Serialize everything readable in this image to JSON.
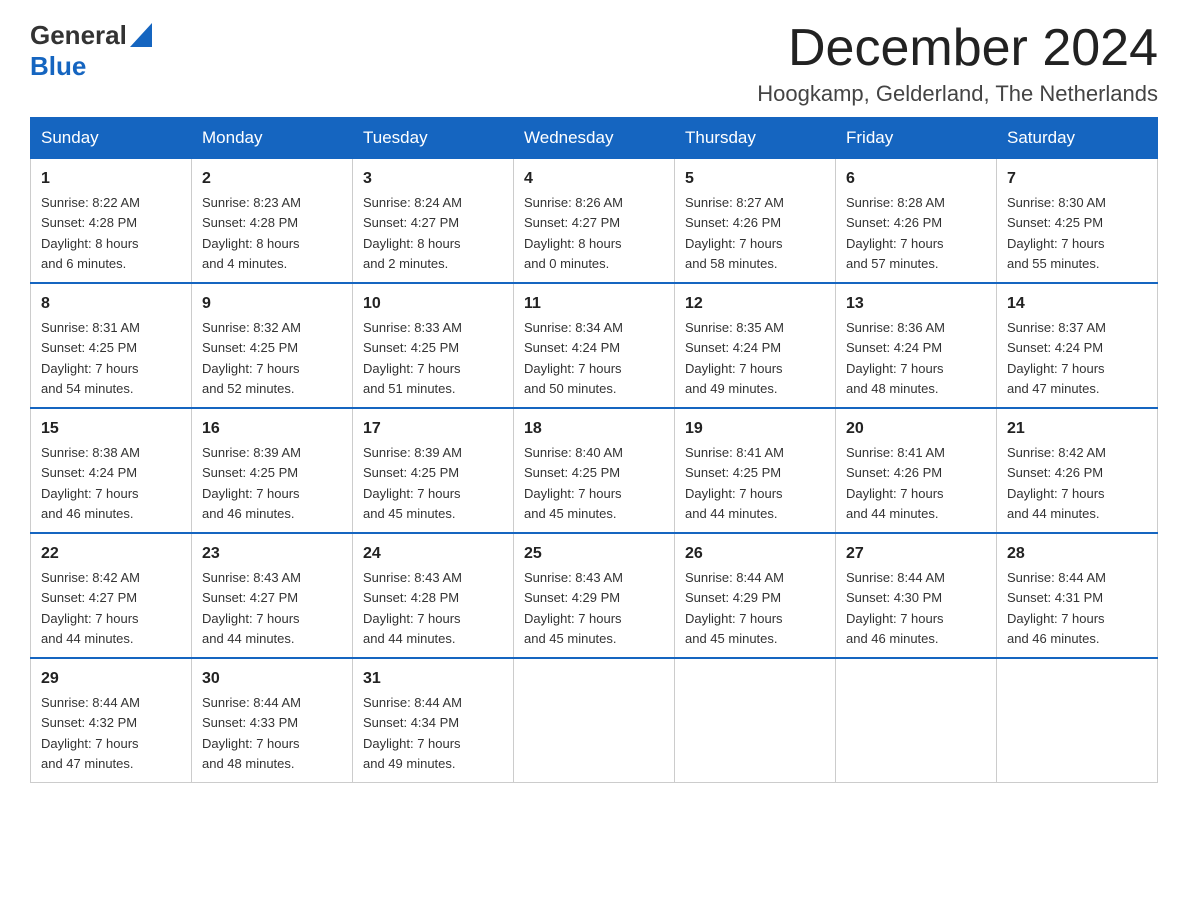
{
  "header": {
    "logo_general": "General",
    "logo_blue": "Blue",
    "month_title": "December 2024",
    "subtitle": "Hoogkamp, Gelderland, The Netherlands"
  },
  "days_of_week": [
    "Sunday",
    "Monday",
    "Tuesday",
    "Wednesday",
    "Thursday",
    "Friday",
    "Saturday"
  ],
  "weeks": [
    [
      {
        "day": "1",
        "info": "Sunrise: 8:22 AM\nSunset: 4:28 PM\nDaylight: 8 hours\nand 6 minutes."
      },
      {
        "day": "2",
        "info": "Sunrise: 8:23 AM\nSunset: 4:28 PM\nDaylight: 8 hours\nand 4 minutes."
      },
      {
        "day": "3",
        "info": "Sunrise: 8:24 AM\nSunset: 4:27 PM\nDaylight: 8 hours\nand 2 minutes."
      },
      {
        "day": "4",
        "info": "Sunrise: 8:26 AM\nSunset: 4:27 PM\nDaylight: 8 hours\nand 0 minutes."
      },
      {
        "day": "5",
        "info": "Sunrise: 8:27 AM\nSunset: 4:26 PM\nDaylight: 7 hours\nand 58 minutes."
      },
      {
        "day": "6",
        "info": "Sunrise: 8:28 AM\nSunset: 4:26 PM\nDaylight: 7 hours\nand 57 minutes."
      },
      {
        "day": "7",
        "info": "Sunrise: 8:30 AM\nSunset: 4:25 PM\nDaylight: 7 hours\nand 55 minutes."
      }
    ],
    [
      {
        "day": "8",
        "info": "Sunrise: 8:31 AM\nSunset: 4:25 PM\nDaylight: 7 hours\nand 54 minutes."
      },
      {
        "day": "9",
        "info": "Sunrise: 8:32 AM\nSunset: 4:25 PM\nDaylight: 7 hours\nand 52 minutes."
      },
      {
        "day": "10",
        "info": "Sunrise: 8:33 AM\nSunset: 4:25 PM\nDaylight: 7 hours\nand 51 minutes."
      },
      {
        "day": "11",
        "info": "Sunrise: 8:34 AM\nSunset: 4:24 PM\nDaylight: 7 hours\nand 50 minutes."
      },
      {
        "day": "12",
        "info": "Sunrise: 8:35 AM\nSunset: 4:24 PM\nDaylight: 7 hours\nand 49 minutes."
      },
      {
        "day": "13",
        "info": "Sunrise: 8:36 AM\nSunset: 4:24 PM\nDaylight: 7 hours\nand 48 minutes."
      },
      {
        "day": "14",
        "info": "Sunrise: 8:37 AM\nSunset: 4:24 PM\nDaylight: 7 hours\nand 47 minutes."
      }
    ],
    [
      {
        "day": "15",
        "info": "Sunrise: 8:38 AM\nSunset: 4:24 PM\nDaylight: 7 hours\nand 46 minutes."
      },
      {
        "day": "16",
        "info": "Sunrise: 8:39 AM\nSunset: 4:25 PM\nDaylight: 7 hours\nand 46 minutes."
      },
      {
        "day": "17",
        "info": "Sunrise: 8:39 AM\nSunset: 4:25 PM\nDaylight: 7 hours\nand 45 minutes."
      },
      {
        "day": "18",
        "info": "Sunrise: 8:40 AM\nSunset: 4:25 PM\nDaylight: 7 hours\nand 45 minutes."
      },
      {
        "day": "19",
        "info": "Sunrise: 8:41 AM\nSunset: 4:25 PM\nDaylight: 7 hours\nand 44 minutes."
      },
      {
        "day": "20",
        "info": "Sunrise: 8:41 AM\nSunset: 4:26 PM\nDaylight: 7 hours\nand 44 minutes."
      },
      {
        "day": "21",
        "info": "Sunrise: 8:42 AM\nSunset: 4:26 PM\nDaylight: 7 hours\nand 44 minutes."
      }
    ],
    [
      {
        "day": "22",
        "info": "Sunrise: 8:42 AM\nSunset: 4:27 PM\nDaylight: 7 hours\nand 44 minutes."
      },
      {
        "day": "23",
        "info": "Sunrise: 8:43 AM\nSunset: 4:27 PM\nDaylight: 7 hours\nand 44 minutes."
      },
      {
        "day": "24",
        "info": "Sunrise: 8:43 AM\nSunset: 4:28 PM\nDaylight: 7 hours\nand 44 minutes."
      },
      {
        "day": "25",
        "info": "Sunrise: 8:43 AM\nSunset: 4:29 PM\nDaylight: 7 hours\nand 45 minutes."
      },
      {
        "day": "26",
        "info": "Sunrise: 8:44 AM\nSunset: 4:29 PM\nDaylight: 7 hours\nand 45 minutes."
      },
      {
        "day": "27",
        "info": "Sunrise: 8:44 AM\nSunset: 4:30 PM\nDaylight: 7 hours\nand 46 minutes."
      },
      {
        "day": "28",
        "info": "Sunrise: 8:44 AM\nSunset: 4:31 PM\nDaylight: 7 hours\nand 46 minutes."
      }
    ],
    [
      {
        "day": "29",
        "info": "Sunrise: 8:44 AM\nSunset: 4:32 PM\nDaylight: 7 hours\nand 47 minutes."
      },
      {
        "day": "30",
        "info": "Sunrise: 8:44 AM\nSunset: 4:33 PM\nDaylight: 7 hours\nand 48 minutes."
      },
      {
        "day": "31",
        "info": "Sunrise: 8:44 AM\nSunset: 4:34 PM\nDaylight: 7 hours\nand 49 minutes."
      },
      {
        "day": "",
        "info": ""
      },
      {
        "day": "",
        "info": ""
      },
      {
        "day": "",
        "info": ""
      },
      {
        "day": "",
        "info": ""
      }
    ]
  ]
}
